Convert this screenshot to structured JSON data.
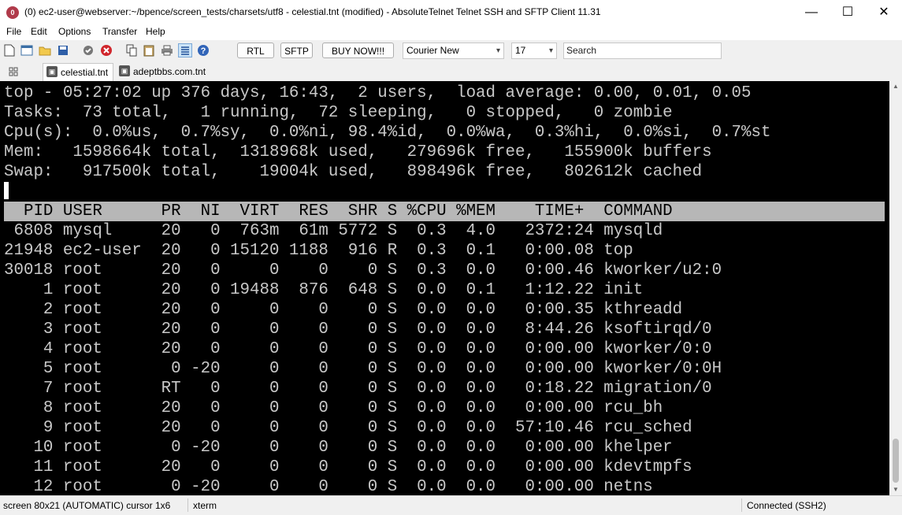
{
  "window": {
    "title": "(0) ec2-user@webserver:~/bpence/screen_tests/charsets/utf8 - celestial.tnt (modified) - AbsoluteTelnet Telnet SSH and SFTP Client 11.31",
    "app_icon_text": "0",
    "minimize": "—",
    "maximize": "☐",
    "close": "✕"
  },
  "menu": [
    "File",
    "Edit",
    "Options",
    "Transfer",
    "Help"
  ],
  "toolbar": {
    "buttons": {
      "rtl": "RTL",
      "sftp": "SFTP",
      "buynow": "BUY NOW!!!"
    },
    "font_combo": "Courier New",
    "size_combo": "17",
    "search_placeholder": "Search"
  },
  "tabs": [
    {
      "label": "celestial.tnt",
      "active": true
    },
    {
      "label": "adeptbbs.com.tnt",
      "active": false
    }
  ],
  "terminal": {
    "summary": [
      "top - 05:27:02 up 376 days, 16:43,  2 users,  load average: 0.00, 0.01, 0.05",
      "Tasks:  73 total,   1 running,  72 sleeping,   0 stopped,   0 zombie",
      "Cpu(s):  0.0%us,  0.7%sy,  0.0%ni, 98.4%id,  0.0%wa,  0.3%hi,  0.0%si,  0.7%st",
      "Mem:   1598664k total,  1318968k used,   279696k free,   155900k buffers",
      "Swap:   917500k total,    19004k used,   898496k free,   802612k cached"
    ],
    "header": "  PID USER      PR  NI  VIRT  RES  SHR S %CPU %MEM    TIME+  COMMAND",
    "processes": [
      " 6808 mysql     20   0  763m  61m 5772 S  0.3  4.0   2372:24 mysqld",
      "21948 ec2-user  20   0 15120 1188  916 R  0.3  0.1   0:00.08 top",
      "30018 root      20   0     0    0    0 S  0.3  0.0   0:00.46 kworker/u2:0",
      "    1 root      20   0 19488  876  648 S  0.0  0.1   1:12.22 init",
      "    2 root      20   0     0    0    0 S  0.0  0.0   0:00.35 kthreadd",
      "    3 root      20   0     0    0    0 S  0.0  0.0   8:44.26 ksoftirqd/0",
      "    4 root      20   0     0    0    0 S  0.0  0.0   0:00.00 kworker/0:0",
      "    5 root       0 -20     0    0    0 S  0.0  0.0   0:00.00 kworker/0:0H",
      "    7 root      RT   0     0    0    0 S  0.0  0.0   0:18.22 migration/0",
      "    8 root      20   0     0    0    0 S  0.0  0.0   0:00.00 rcu_bh",
      "    9 root      20   0     0    0    0 S  0.0  0.0  57:10.46 rcu_sched",
      "   10 root       0 -20     0    0    0 S  0.0  0.0   0:00.00 khelper",
      "   11 root      20   0     0    0    0 S  0.0  0.0   0:00.00 kdevtmpfs",
      "   12 root       0 -20     0    0    0 S  0.0  0.0   0:00.00 netns"
    ]
  },
  "status": {
    "screen": "screen 80x21 (AUTOMATIC) cursor 1x6",
    "term": "xterm",
    "connection": "Connected (SSH2)"
  },
  "colors": {
    "terminal_bg": "#000000",
    "terminal_fg": "#c8c8c8",
    "header_bg": "#b7b7b7",
    "app_icon": "#b03a4a"
  }
}
